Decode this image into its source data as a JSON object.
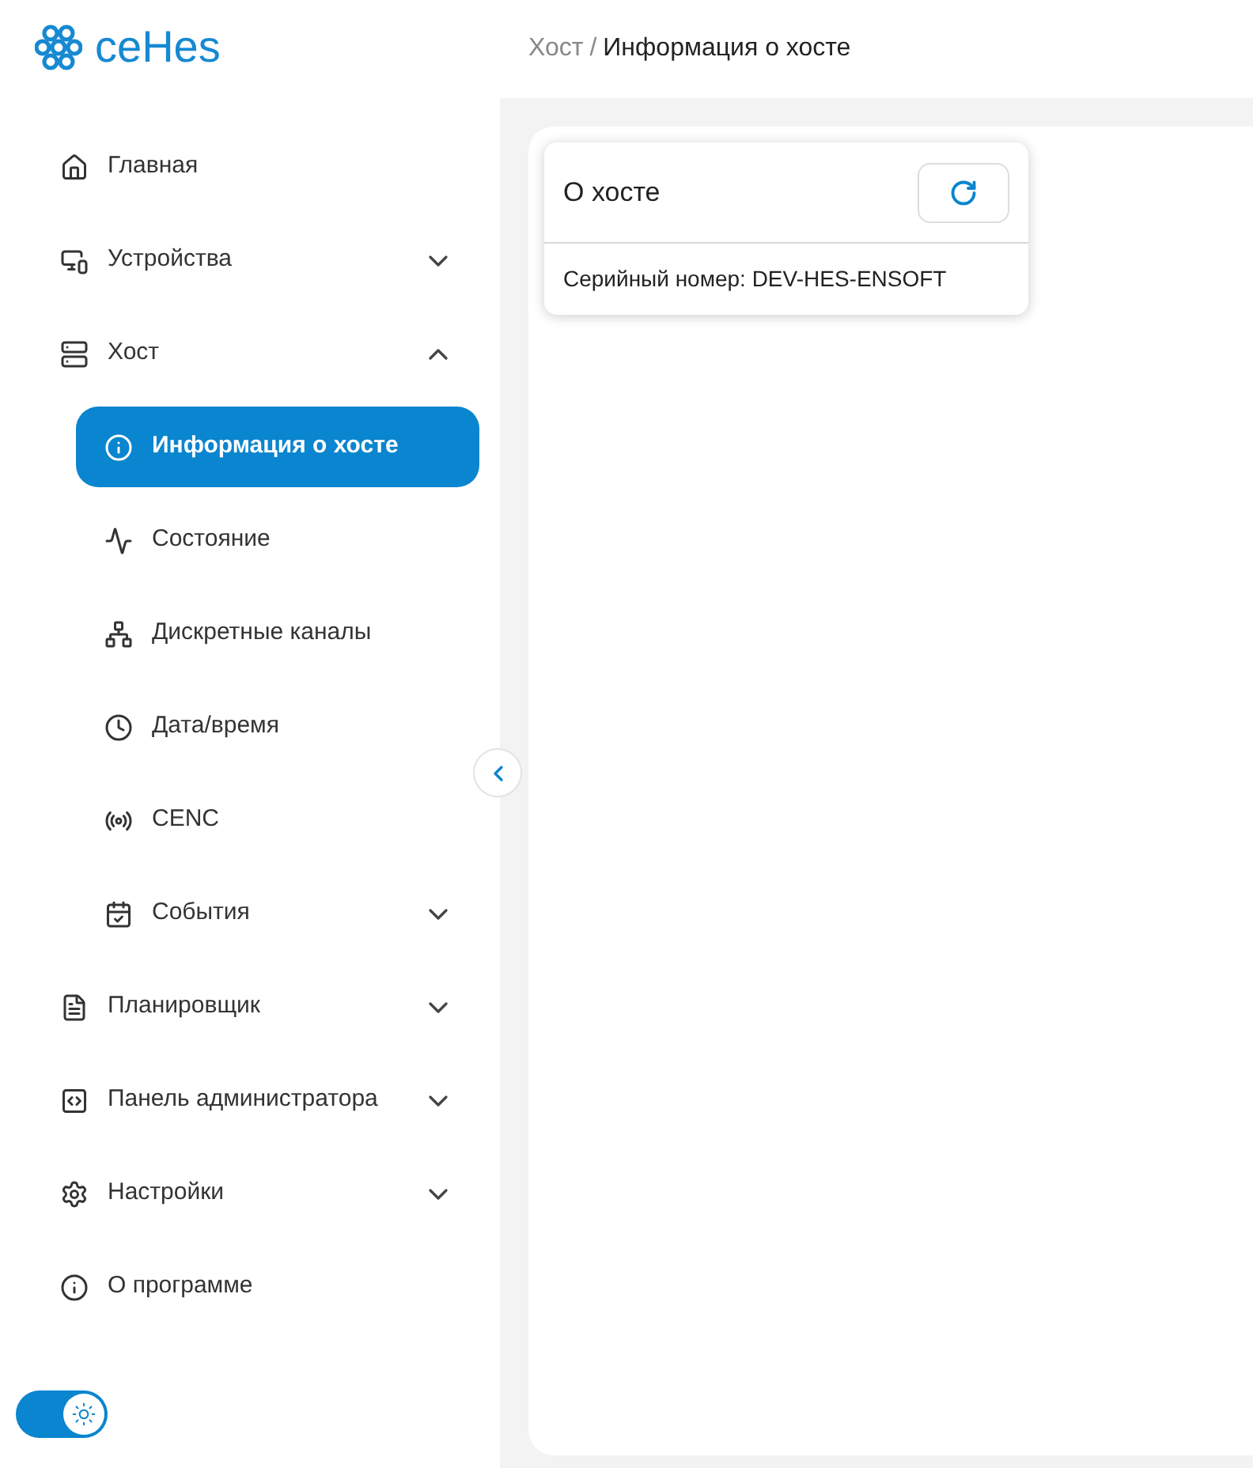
{
  "logo": {
    "text": "ceHes"
  },
  "sidebar": {
    "items": [
      {
        "label": "Главная"
      },
      {
        "label": "Устройства",
        "expanded": false
      },
      {
        "label": "Хост",
        "expanded": true,
        "children": [
          {
            "label": "Информация о хосте",
            "selected": true
          },
          {
            "label": "Состояние",
            "selected": false
          },
          {
            "label": "Дискретные каналы",
            "selected": false
          },
          {
            "label": "Дата/время",
            "selected": false
          },
          {
            "label": "CENC",
            "selected": false
          },
          {
            "label": "События",
            "selected": false,
            "expanded": false
          }
        ]
      },
      {
        "label": "Планировщик",
        "expanded": false
      },
      {
        "label": "Панель администратора",
        "expanded": false
      },
      {
        "label": "Настройки",
        "expanded": false
      },
      {
        "label": "О программе"
      }
    ]
  },
  "theme_toggle": {
    "on": true
  },
  "breadcrumb": {
    "parent": "Хост",
    "separator": "/",
    "current": "Информация о хосте"
  },
  "card": {
    "title": "О хосте",
    "lines": [
      "Серийный номер: DEV-HES-ENSOFT"
    ]
  }
}
